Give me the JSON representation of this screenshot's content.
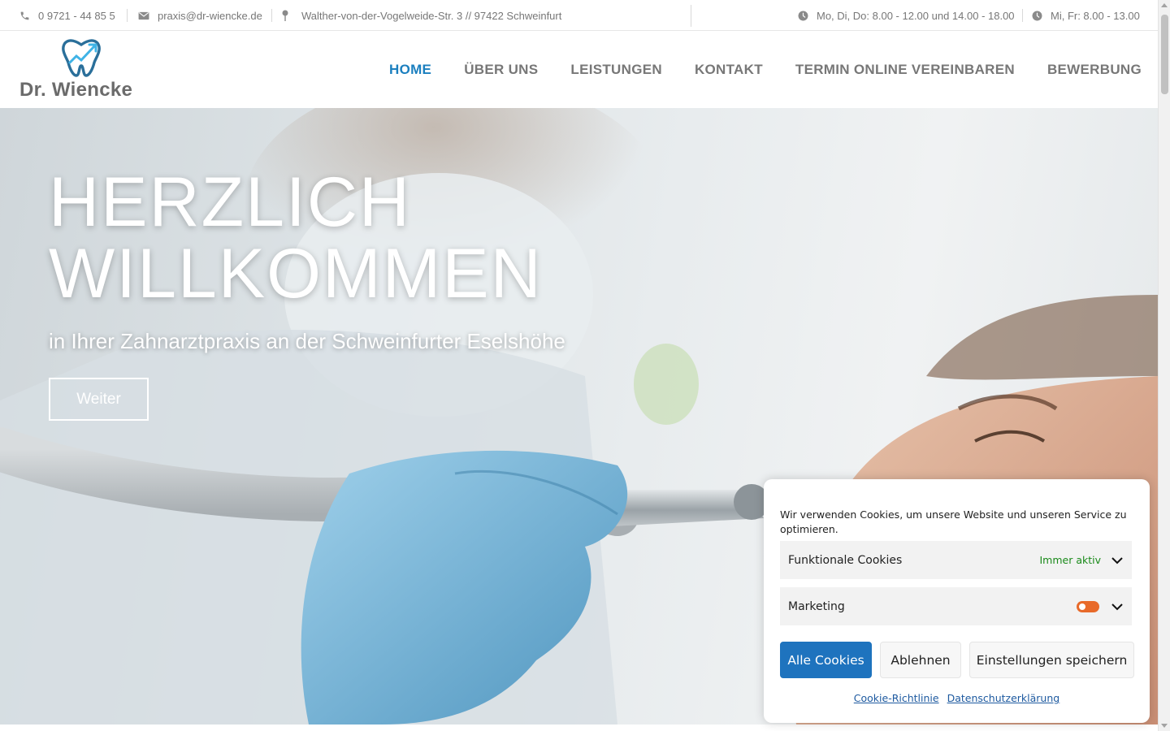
{
  "topbar": {
    "phone": "0 9721 - 44 85 5",
    "email": "praxis@dr-wiencke.de",
    "address": "Walther-von-der-Vogelweide-Str. 3 // 97422 Schweinfurt",
    "hours_1": "Mo, Di, Do: 8.00 - 12.00 und 14.00 - 18.00",
    "hours_2": "Mi, Fr: 8.00 - 13.00"
  },
  "header": {
    "logo_text": "Dr. Wiencke",
    "nav": [
      {
        "label": "HOME",
        "active": true
      },
      {
        "label": "ÜBER UNS"
      },
      {
        "label": "LEISTUNGEN"
      },
      {
        "label": "KONTAKT"
      },
      {
        "label": "TERMIN ONLINE VEREINBAREN"
      },
      {
        "label": "BEWERBUNG"
      }
    ]
  },
  "hero": {
    "title_line1": "HERZLICH",
    "title_line2": "WILLKOMMEN",
    "subtitle": "in Ihrer Zahnarztpraxis an der Schweinfurter Eselshöhe",
    "button": "Weiter"
  },
  "cookie": {
    "text": "Wir verwenden Cookies, um unsere Website und unseren Service zu optimieren.",
    "functional_label": "Funktionale Cookies",
    "functional_status": "Immer aktiv",
    "marketing_label": "Marketing",
    "btn_accept": "Alle Cookies",
    "btn_deny": "Ablehnen",
    "btn_save": "Einstellungen speichern",
    "link_policy": "Cookie-Richtlinie",
    "link_privacy": "Datenschutzerklärung"
  },
  "colors": {
    "accent": "#1b7fbf",
    "nav_text": "#777777",
    "cookie_primary": "#1e73be",
    "toggle_on": "#e86a2a",
    "always_active": "#1a8a1a"
  }
}
